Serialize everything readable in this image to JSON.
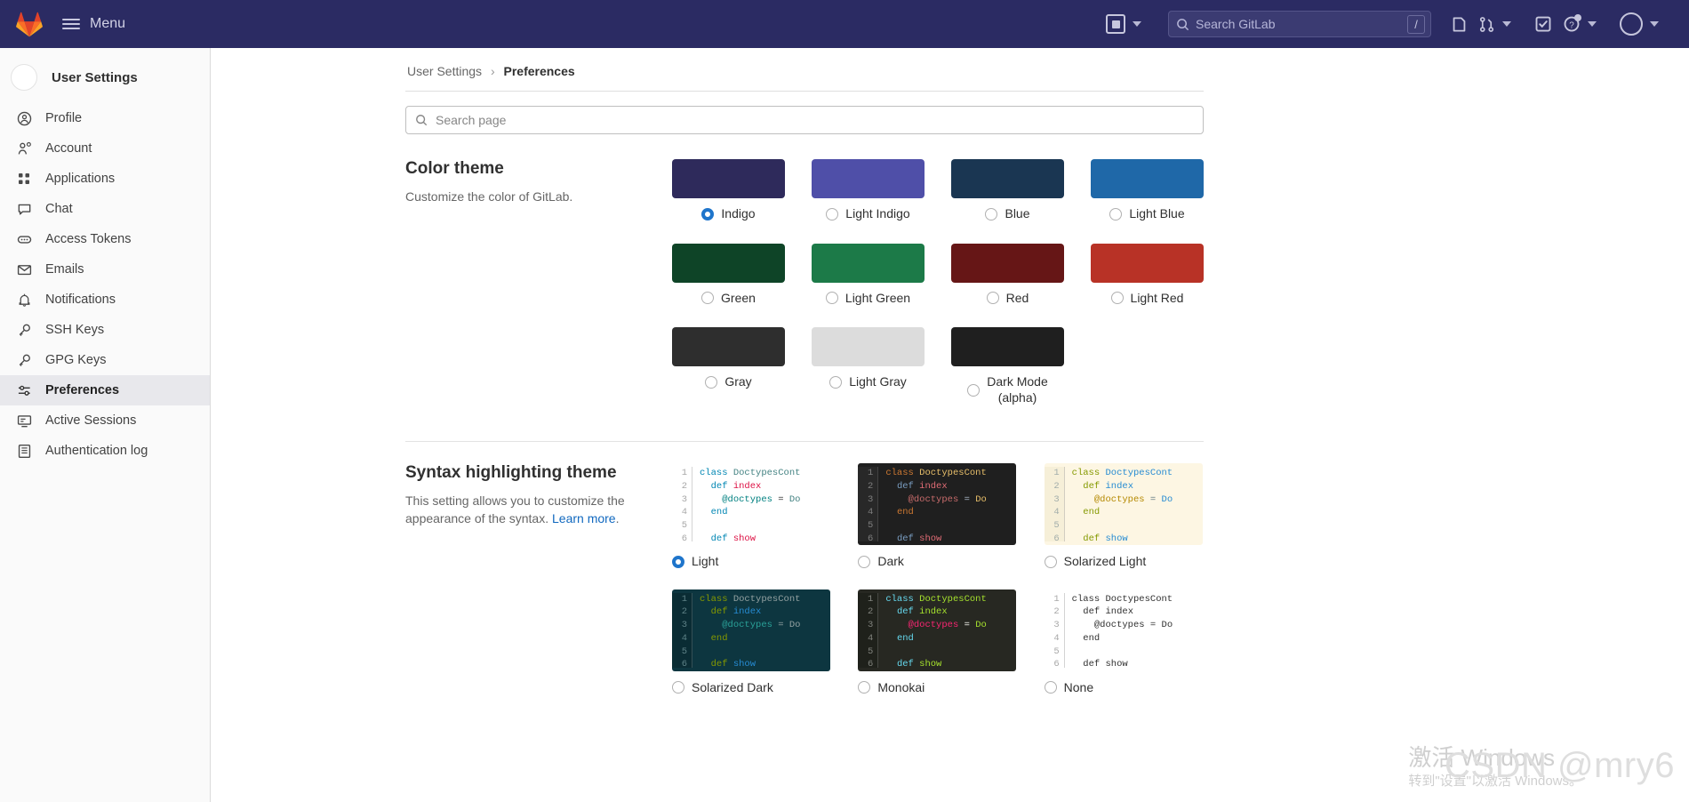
{
  "topnav": {
    "logo_icon": "gitlab-logo-icon",
    "menu_label": "Menu",
    "hamburger_icon": "hamburger-icon",
    "new_icon": "new-item-icon",
    "new_chevron_icon": "chevron-down-icon",
    "search_placeholder": "Search GitLab",
    "search_icon": "search-icon",
    "search_shortcut": "/",
    "issues_icon": "issues-icon",
    "merge_requests_icon": "merge-request-icon",
    "mr_chevron_icon": "chevron-down-icon",
    "todos_icon": "todos-checkbox-icon",
    "help_icon": "help-question-icon",
    "help_chevron_icon": "chevron-down-icon",
    "avatar_icon": "user-avatar",
    "avatar_chevron_icon": "chevron-down-icon"
  },
  "sidebar": {
    "header_title": "User Settings",
    "header_avatar": "user-avatar",
    "items": [
      {
        "label": "Profile",
        "icon": "profile-icon",
        "active": false
      },
      {
        "label": "Account",
        "icon": "account-icon",
        "active": false
      },
      {
        "label": "Applications",
        "icon": "applications-icon",
        "active": false
      },
      {
        "label": "Chat",
        "icon": "chat-icon",
        "active": false
      },
      {
        "label": "Access Tokens",
        "icon": "token-icon",
        "active": false
      },
      {
        "label": "Emails",
        "icon": "email-icon",
        "active": false
      },
      {
        "label": "Notifications",
        "icon": "bell-icon",
        "active": false
      },
      {
        "label": "SSH Keys",
        "icon": "key-icon",
        "active": false
      },
      {
        "label": "GPG Keys",
        "icon": "key-icon",
        "active": false
      },
      {
        "label": "Preferences",
        "icon": "preferences-icon",
        "active": true
      },
      {
        "label": "Active Sessions",
        "icon": "monitor-icon",
        "active": false
      },
      {
        "label": "Authentication log",
        "icon": "log-icon",
        "active": false
      }
    ]
  },
  "breadcrumb": {
    "root": "User Settings",
    "separator": "›",
    "current": "Preferences"
  },
  "page_search": {
    "placeholder": "Search page",
    "icon": "search-icon",
    "value": ""
  },
  "color_theme": {
    "title": "Color theme",
    "description": "Customize the color of GitLab.",
    "options": [
      {
        "label": "Indigo",
        "color": "#2e2a5b",
        "selected": true
      },
      {
        "label": "Light Indigo",
        "color": "#4f4fa8",
        "selected": false
      },
      {
        "label": "Blue",
        "color": "#1a3652",
        "selected": false
      },
      {
        "label": "Light Blue",
        "color": "#1f68a8",
        "selected": false
      },
      {
        "label": "Green",
        "color": "#0e4427",
        "selected": false
      },
      {
        "label": "Light Green",
        "color": "#1c7a48",
        "selected": false
      },
      {
        "label": "Red",
        "color": "#661616",
        "selected": false
      },
      {
        "label": "Light Red",
        "color": "#b83226",
        "selected": false
      },
      {
        "label": "Gray",
        "color": "#2e2e2e",
        "selected": false
      },
      {
        "label": "Light Gray",
        "color": "#dcdcdc",
        "selected": false
      },
      {
        "label": "Dark Mode\n(alpha)",
        "color": "#1f1f1f",
        "selected": false
      }
    ]
  },
  "syntax_theme": {
    "title": "Syntax highlighting theme",
    "description_1": "This setting allows you to customize the appearance of the syntax. ",
    "learn_more": "Learn more",
    "description_2": ".",
    "line_numbers": [
      "1",
      "2",
      "3",
      "4",
      "5",
      "6"
    ],
    "code_lines": [
      "class DoctypesCont",
      "  def index",
      "    @doctypes = Do",
      "  end",
      "",
      "  def show"
    ],
    "options": [
      {
        "label": "Light",
        "selected": true,
        "bg": "#ffffff",
        "gutter_bg": "#ffffff",
        "gutter_fg": "#999999",
        "kw": "#0086b3",
        "cls": "#458383",
        "fn": "#0086b3",
        "name": "#d14",
        "ivar": "#008080",
        "op": "#333333",
        "txt": "#333333"
      },
      {
        "label": "Dark",
        "selected": false,
        "bg": "#1f1f1f",
        "gutter_bg": "#2b2b2b",
        "gutter_fg": "#8f8f8f",
        "kw": "#cc7832",
        "cls": "#e8bf6a",
        "fn": "#7a9ec2",
        "name": "#e06c75",
        "ivar": "#c76b6b",
        "op": "#a9b7c6",
        "txt": "#a9b7c6"
      },
      {
        "label": "Solarized Light",
        "selected": false,
        "bg": "#fdf6e3",
        "gutter_bg": "#f5eed6",
        "gutter_fg": "#93a1a1",
        "kw": "#859900",
        "cls": "#268bd2",
        "fn": "#859900",
        "name": "#268bd2",
        "ivar": "#b58900",
        "op": "#657b83",
        "txt": "#657b83"
      },
      {
        "label": "Solarized Dark",
        "selected": false,
        "bg": "#0d3640",
        "gutter_bg": "#0a2b33",
        "gutter_fg": "#6c8f93",
        "kw": "#859900",
        "cls": "#93a1a1",
        "fn": "#859900",
        "name": "#268bd2",
        "ivar": "#2aa198",
        "op": "#93a1a1",
        "txt": "#93a1a1"
      },
      {
        "label": "Monokai",
        "selected": false,
        "bg": "#272822",
        "gutter_bg": "#1f201b",
        "gutter_fg": "#90918b",
        "kw": "#66d9ef",
        "cls": "#a6e22e",
        "fn": "#66d9ef",
        "name": "#a6e22e",
        "ivar": "#f92672",
        "op": "#f8f8f2",
        "txt": "#f8f8f2"
      },
      {
        "label": "None",
        "selected": false,
        "bg": "#ffffff",
        "gutter_bg": "#ffffff",
        "gutter_fg": "#999999",
        "kw": "#303030",
        "cls": "#303030",
        "fn": "#303030",
        "name": "#303030",
        "ivar": "#303030",
        "op": "#303030",
        "txt": "#303030"
      }
    ]
  },
  "watermarks": {
    "windows_line1": "激活 Windows",
    "windows_line2": "转到\"设置\"以激活 Windows。",
    "csdn": "CSDN @mry6"
  }
}
